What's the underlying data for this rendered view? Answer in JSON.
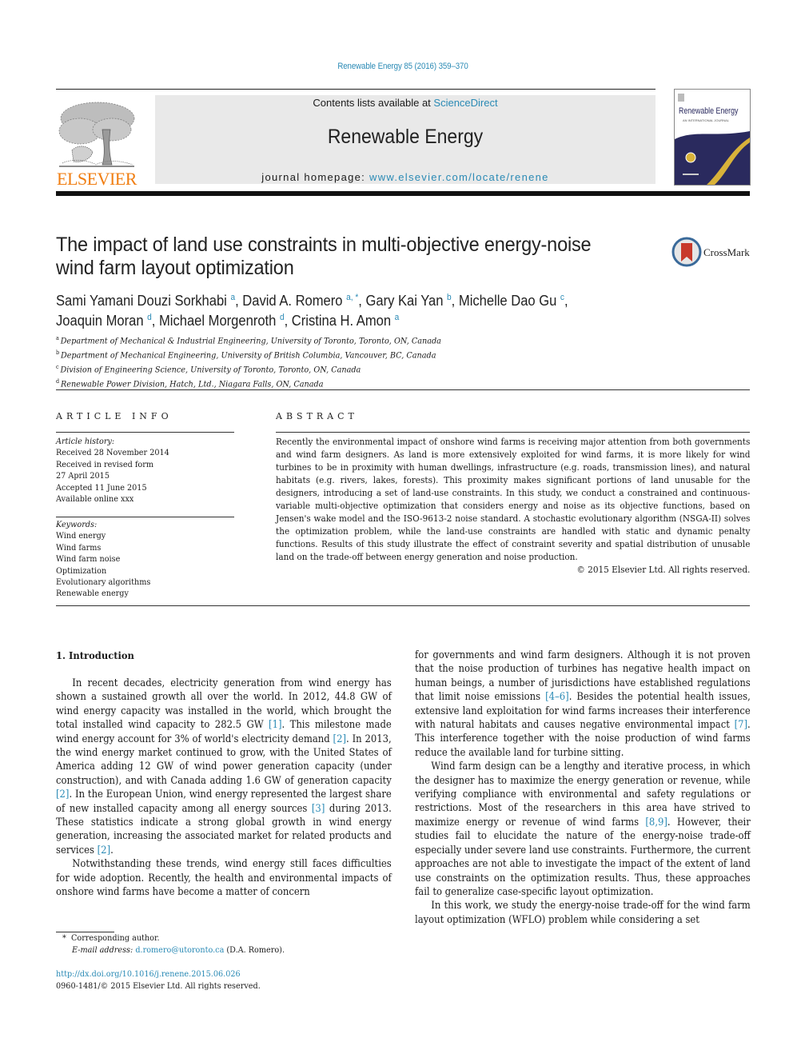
{
  "header": {
    "journal_ref": "Renewable Energy 85 (2016) 359–370",
    "contents_prefix": "Contents lists available at ",
    "contents_link": "ScienceDirect",
    "journal_name": "Renewable Energy",
    "homepage_prefix": "journal homepage: ",
    "homepage_link": "www.elsevier.com/locate/renene",
    "publisher_logo_text": "ELSEVIER",
    "cover": {
      "title": "Renewable Energy",
      "subtitle": "AN INTERNATIONAL JOURNAL",
      "colors": {
        "navy": "#2a2a5e",
        "gold": "#d8b23a"
      }
    },
    "crossmark_label": "CrossMark"
  },
  "article": {
    "title_line1": "The impact of land use constraints in multi-objective energy-noise",
    "title_line2": "wind farm layout optimization",
    "authors": [
      {
        "name": "Sami Yamani Douzi Sorkhabi",
        "aff": "a",
        "sep": ", "
      },
      {
        "name": "David A. Romero",
        "aff": "a, *",
        "sep": ", "
      },
      {
        "name": "Gary Kai Yan",
        "aff": "b",
        "sep": ", "
      },
      {
        "name": "Michelle Dao Gu",
        "aff": "c",
        "sep": ","
      },
      {
        "name": "Joaquin Moran",
        "aff": "d",
        "sep": ", "
      },
      {
        "name": "Michael Morgenroth",
        "aff": "d",
        "sep": ", "
      },
      {
        "name": "Cristina H. Amon",
        "aff": "a",
        "sep": ""
      }
    ],
    "affiliations": [
      {
        "key": "a",
        "text": "Department of Mechanical & Industrial Engineering, University of Toronto, Toronto, ON, Canada"
      },
      {
        "key": "b",
        "text": "Department of Mechanical Engineering, University of British Columbia, Vancouver, BC, Canada"
      },
      {
        "key": "c",
        "text": "Division of Engineering Science, University of Toronto, Toronto, ON, Canada"
      },
      {
        "key": "d",
        "text": "Renewable Power Division, Hatch, Ltd., Niagara Falls, ON, Canada"
      }
    ]
  },
  "article_info": {
    "heading": "ARTICLE INFO",
    "history_label": "Article history:",
    "history": [
      "Received 28 November 2014",
      "Received in revised form",
      "27 April 2015",
      "Accepted 11 June 2015",
      "Available online xxx"
    ],
    "keywords_label": "Keywords:",
    "keywords": [
      "Wind energy",
      "Wind farms",
      "Wind farm noise",
      "Optimization",
      "Evolutionary algorithms",
      "Renewable energy"
    ]
  },
  "abstract": {
    "heading": "ABSTRACT",
    "text": "Recently the environmental impact of onshore wind farms is receiving major attention from both governments and wind farm designers. As land is more extensively exploited for wind farms, it is more likely for wind turbines to be in proximity with human dwellings, infrastructure (e.g. roads, transmission lines), and natural habitats (e.g. rivers, lakes, forests). This proximity makes significant portions of land unusable for the designers, introducing a set of land-use constraints. In this study, we conduct a constrained and continuous-variable multi-objective optimization that considers energy and noise as its objective functions, based on Jensen's wake model and the ISO-9613-2 noise standard. A stochastic evolutionary algorithm (NSGA-II) solves the optimization problem, while the land-use constraints are handled with static and dynamic penalty functions. Results of this study illustrate the effect of constraint severity and spatial distribution of unusable land on the trade-off between energy generation and noise production.",
    "copyright": "© 2015 Elsevier Ltd. All rights reserved."
  },
  "body": {
    "intro_heading": "1.  Introduction",
    "left_paragraphs": [
      [
        {
          "t": "In recent decades, electricity generation from wind energy has shown a sustained growth all over the world. In 2012, 44.8 GW of wind energy capacity was installed in the world, which brought the total installed wind capacity to 282.5 GW "
        },
        {
          "ref": "[1]"
        },
        {
          "t": ". This milestone made wind energy account for 3% of world's electricity demand "
        },
        {
          "ref": "[2]"
        },
        {
          "t": ". In 2013, the wind energy market continued to grow, with the United States of America adding 12 GW of wind power generation capacity (under construction), and with Canada adding 1.6 GW of generation capacity "
        },
        {
          "ref": "[2]"
        },
        {
          "t": ". In the European Union, wind energy represented the largest share of new installed capacity among all energy sources "
        },
        {
          "ref": "[3]"
        },
        {
          "t": " during 2013. These statistics indicate a strong global growth in wind energy generation, increasing the associated market for related products and services "
        },
        {
          "ref": "[2]"
        },
        {
          "t": "."
        }
      ],
      [
        {
          "t": "Notwithstanding these trends, wind energy still faces difficulties for wide adoption. Recently, the health and environmental impacts of onshore wind farms have become a matter of concern"
        }
      ]
    ],
    "right_paragraphs": [
      [
        {
          "t": "for governments and wind farm designers. Although it is not proven that the noise production of turbines has negative health impact on human beings, a number of jurisdictions have established regulations that limit noise emissions "
        },
        {
          "ref": "[4–6]"
        },
        {
          "t": ". Besides the potential health issues, extensive land exploitation for wind farms increases their interference with natural habitats and causes negative environmental impact "
        },
        {
          "ref": "[7]"
        },
        {
          "t": ". This interference together with the noise production of wind farms reduce the available land for turbine sitting."
        }
      ],
      [
        {
          "t": "Wind farm design can be a lengthy and iterative process, in which the designer has to maximize the energy generation or revenue, while verifying compliance with environmental and safety regulations or restrictions. Most of the researchers in this area have strived to maximize energy or revenue of wind farms "
        },
        {
          "ref": "[8,9]"
        },
        {
          "t": ". However, their studies fail to elucidate the nature of the energy-noise trade-off especially under severe land use constraints. Furthermore, the current approaches are not able to investigate the impact of the extent of land use constraints on the optimization results. Thus, these approaches fail to generalize case-specific layout optimization."
        }
      ],
      [
        {
          "t": "In this work, we study the energy-noise trade-off for the wind farm layout optimization (WFLO) problem while considering a set"
        }
      ]
    ]
  },
  "footnote": {
    "marker": "*",
    "corresponding": "Corresponding author.",
    "email_label": "E-mail address:",
    "email": "d.romero@utoronto.ca",
    "email_suffix": " (D.A. Romero)."
  },
  "doi": {
    "link": "http://dx.doi.org/10.1016/j.renene.2015.06.026",
    "issn_line": "0960-1481/© 2015 Elsevier Ltd. All rights reserved."
  },
  "colors": {
    "link": "#2a8ab5",
    "elsevier_orange": "#f07e12",
    "masthead_gray": "#e9e9e9"
  }
}
